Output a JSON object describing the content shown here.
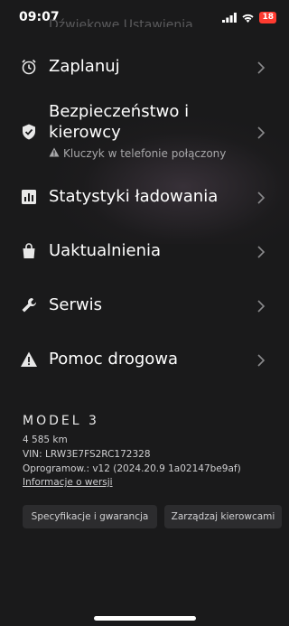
{
  "status_bar": {
    "time": "09:07",
    "battery_level": "18",
    "icons": [
      "signal-icon",
      "wifi-icon",
      "battery-icon"
    ]
  },
  "previous_item_label": "Dźwiękowe Ustawienia",
  "menu": [
    {
      "label": "Zaplanuj",
      "icon": "alarm-clock-icon"
    },
    {
      "label_line1": "Bezpieczeństwo i",
      "label_line2": "kierowcy",
      "sub": "Kluczyk w telefonie połączony",
      "icon": "shield-check-icon",
      "sub_icon": "warning-icon"
    },
    {
      "label": "Statystyki ładowania",
      "icon": "bar-chart-icon"
    },
    {
      "label": "Uaktualnienia",
      "icon": "shopping-bag-icon"
    },
    {
      "label": "Serwis",
      "icon": "wrench-icon"
    },
    {
      "label": "Pomoc drogowa",
      "icon": "warning-icon"
    }
  ],
  "vehicle": {
    "model": "MODEL 3",
    "odometer": "4 585 km",
    "vin": "VIN: LRW3E7FS2RC172328",
    "software": "Oprogramow.: v12 (2024.20.9 1a02147be9af)",
    "version_link": "Informacje o wersji"
  },
  "buttons": {
    "specs": "Specyfikacje i gwarancja",
    "drivers": "Zarządzaj kierowcami"
  },
  "colors": {
    "background": "#1a1a1b",
    "text": "#ffffff",
    "muted": "#a8a8aa",
    "button_bg": "#2c2c2e",
    "battery_badge": "#ff3b30"
  }
}
